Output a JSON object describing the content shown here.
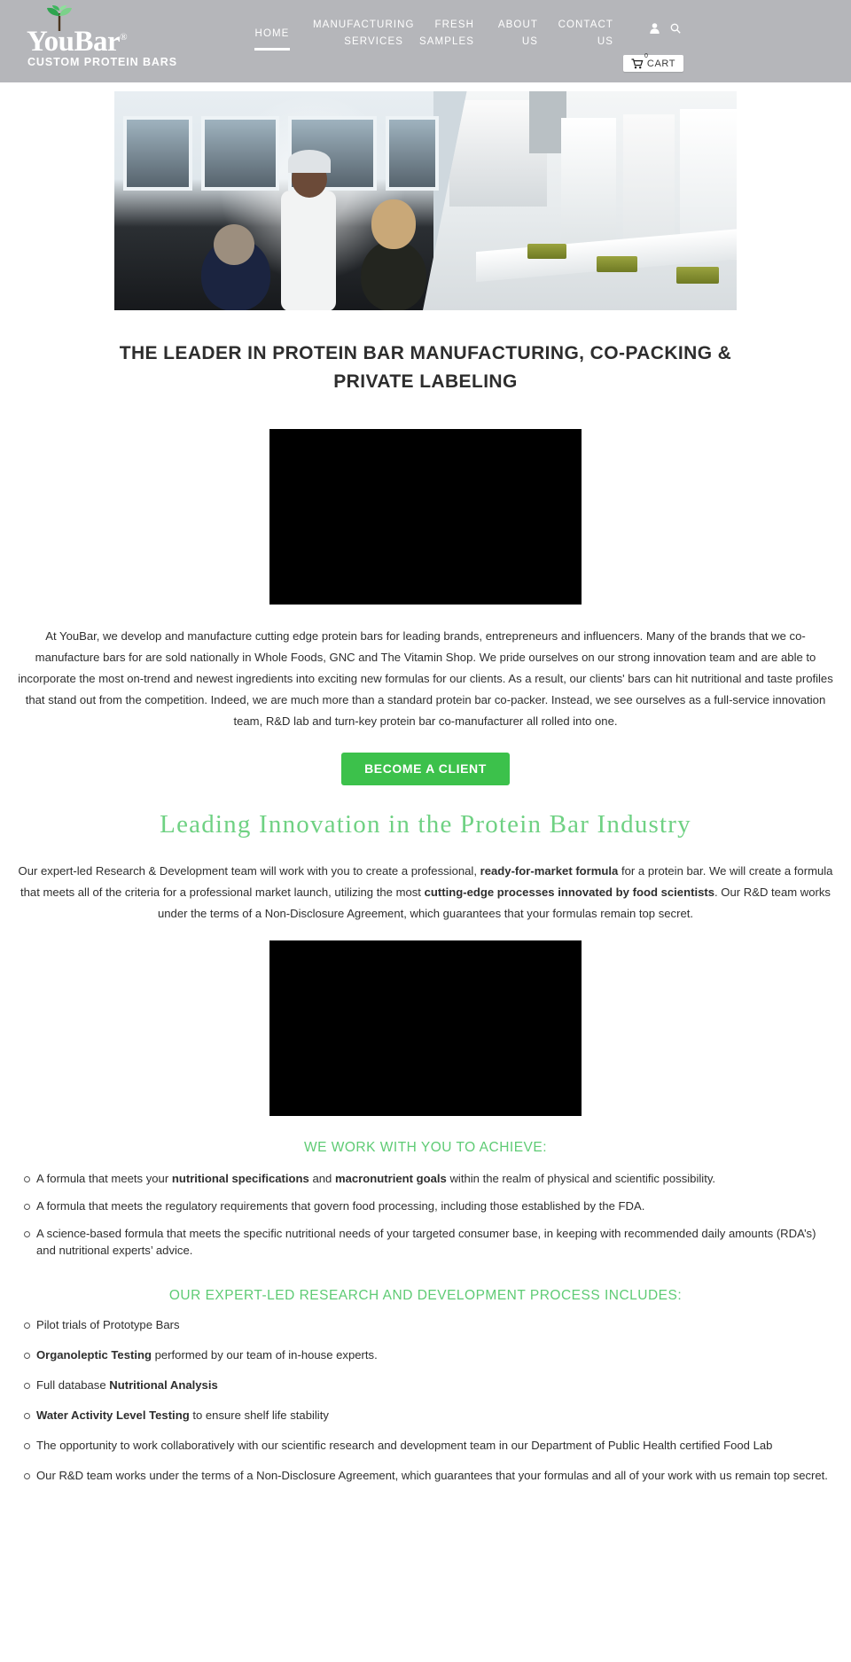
{
  "header": {
    "logo": {
      "word": "YouBar",
      "registered": "®",
      "tagline": "CUSTOM PROTEIN BARS",
      "sprout_icon": "sprout-icon"
    },
    "nav": [
      {
        "id": "home",
        "line1": "HOME",
        "line2": "",
        "active": true
      },
      {
        "id": "manufacturing",
        "line1": "MANUFACTURING",
        "line2": "SERVICES",
        "active": false
      },
      {
        "id": "fresh",
        "line1": "FRESH",
        "line2": "SAMPLES",
        "active": false
      },
      {
        "id": "about",
        "line1": "ABOUT",
        "line2": "US",
        "active": false
      },
      {
        "id": "contact",
        "line1": "CONTACT",
        "line2": "US",
        "active": false
      }
    ],
    "account_icon": "user-icon",
    "search_icon": "search-icon",
    "cart": {
      "label": "CART",
      "count": "0",
      "icon": "shopping-cart-icon"
    }
  },
  "hero": {
    "image_alt": "protein-bar-manufacturing-facility-photo"
  },
  "main": {
    "headline": "THE LEADER IN PROTEIN BAR MANUFACTURING, CO-PACKING & PRIVATE LABELING",
    "video_one": "intro-video-player",
    "intro_paragraph": "At YouBar, we develop and manufacture cutting edge protein bars for leading brands, entrepreneurs and influencers. Many of the brands that we co-manufacture bars for are sold nationally in Whole Foods, GNC and The Vitamin Shop. We pride ourselves on our strong innovation team and are able to incorporate the most on-trend and newest ingredients into exciting new formulas for our clients. As a result, our clients' bars can hit nutritional and taste profiles that stand out from the competition. Indeed, we are much more than a standard protein bar co-packer. Instead, we see ourselves as a full-service innovation team, R&D lab and turn-key protein bar co-manufacturer all rolled into one.",
    "cta_label": "BECOME A CLIENT",
    "script_heading": "Leading Innovation in the Protein Bar Industry",
    "rnd_paragraph_parts": {
      "p1": "Our expert-led Research & Development team will work with you to create a professional, ",
      "b1": "ready-for-market formula",
      "p2": " for a protein bar. We will create a formula that meets all of the criteria for a professional market launch, utilizing the most ",
      "b2": "cutting-edge processes innovated by food scientists",
      "p3": ". Our R&D team works under the terms of a Non-Disclosure Agreement, which guarantees that your formulas remain top secret."
    },
    "video_two": "rnd-video-player",
    "achieve_heading": "WE WORK WITH YOU TO ACHIEVE:",
    "achieve_items": [
      {
        "p1": "A formula that meets your ",
        "b1": "nutritional specifications",
        "p2": " and ",
        "b2": "macronutrient goals",
        "p3": " within the realm of physical and scientific possibility."
      },
      {
        "p1": "A formula that meets the regulatory requirements that govern food processing, including those established by the FDA.",
        "b1": "",
        "p2": "",
        "b2": "",
        "p3": ""
      },
      {
        "p1": "A science-based formula that meets the specific nutritional needs of your targeted consumer base, in keeping with recommended daily amounts (RDA’s) and nutritional experts’ advice.",
        "b1": "",
        "p2": "",
        "b2": "",
        "p3": ""
      }
    ],
    "process_heading": "OUR EXPERT-LED RESEARCH AND DEVELOPMENT PROCESS INCLUDES:",
    "process_items": [
      {
        "p1": "Pilot trials of Prototype Bars",
        "b1": "",
        "p2": "",
        "b2": "",
        "p3": ""
      },
      {
        "p1": "",
        "b1": "Organoleptic Testing",
        "p2": " performed by our team of in-house experts.",
        "b2": "",
        "p3": ""
      },
      {
        "p1": "Full database ",
        "b1": "Nutritional Analysis",
        "p2": "",
        "b2": "",
        "p3": ""
      },
      {
        "p1": "",
        "b1": "Water Activity Level Testing",
        "p2": " to ensure shelf life stability",
        "b2": "",
        "p3": ""
      },
      {
        "p1": "The opportunity to work collaboratively with our scientific research and development team in our Department of Public Health certified Food Lab",
        "b1": "",
        "p2": "",
        "b2": "",
        "p3": ""
      },
      {
        "p1": "Our R&D team works under the terms of a Non-Disclosure Agreement, which guarantees that your formulas and all of your work with us remain top secret.",
        "b1": "",
        "p2": "",
        "b2": "",
        "p3": ""
      }
    ]
  },
  "colors": {
    "header_bg": "#b5b6ba",
    "cta_green": "#3cc14b",
    "heading_green": "#5ecb74",
    "script_green": "#6fd183",
    "body_text": "#2e2e2e"
  }
}
